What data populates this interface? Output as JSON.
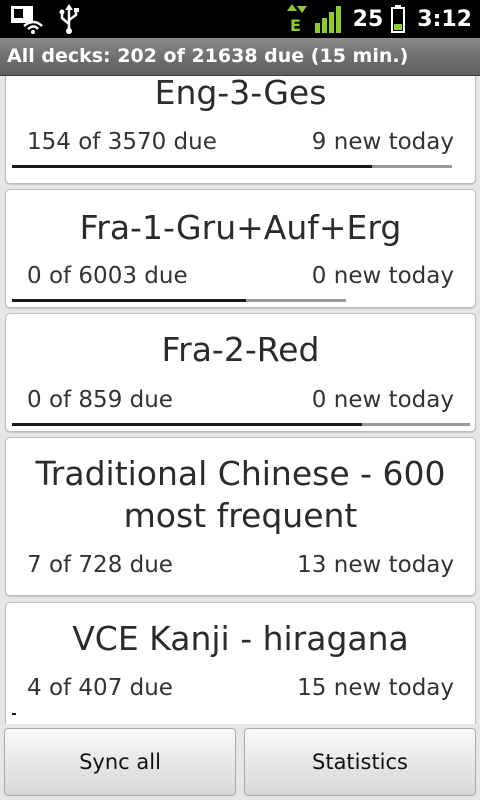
{
  "status_bar": {
    "icons": [
      "sim-card-icon",
      "usb-icon",
      "edge-data-icon",
      "signal-icon",
      "battery-icon"
    ],
    "battery_pct": "25",
    "clock": "3:12"
  },
  "title_bar": {
    "text": "All decks: 202 of 21638 due (15 min.)"
  },
  "decks": [
    {
      "name": "Eng-3-Ges",
      "due": "154 of 3570 due",
      "new": "9 new today",
      "progress": [
        0.87,
        1.0
      ]
    },
    {
      "name": "Fra-1-Gru+Auf+Erg",
      "due": "0 of 6003 due",
      "new": "0 new today",
      "progress": [
        0.43,
        0.76
      ]
    },
    {
      "name": "Fra-2-Red",
      "due": "0 of 859 due",
      "new": "0 new today",
      "progress": [
        0.77,
        1.0
      ]
    },
    {
      "name_line1": "Traditional Chinese - 600",
      "name_line2": "most frequent",
      "due": "7 of 728 due",
      "new": "13 new today"
    },
    {
      "name": "VCE Kanji - hiragana",
      "due": "4 of 407 due",
      "new": "15 new today",
      "progress": [
        0.01,
        0.01
      ]
    }
  ],
  "buttons": {
    "sync": "Sync all",
    "stats": "Statistics"
  }
}
